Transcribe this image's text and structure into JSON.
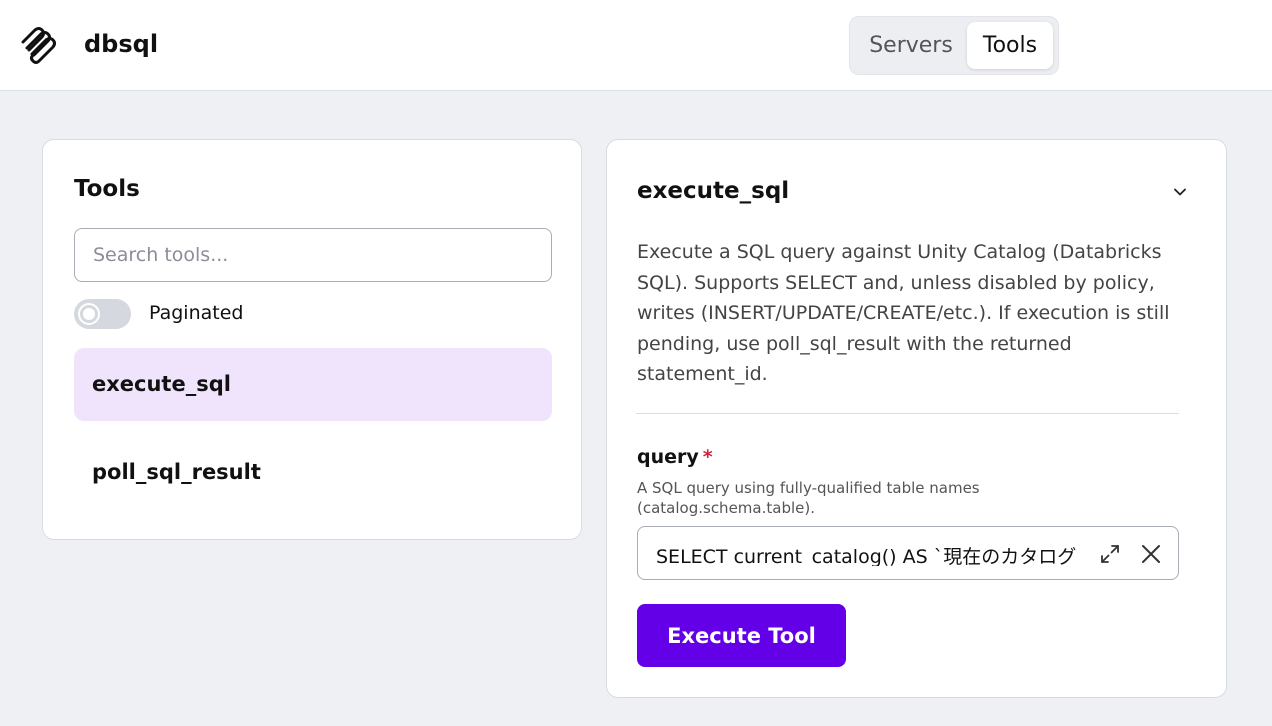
{
  "app": {
    "title": "dbsql",
    "logo_icon": "paperclip-stack-icon"
  },
  "nav": {
    "segments": [
      {
        "label": "Servers",
        "selected": false
      },
      {
        "label": "Tools",
        "selected": true
      }
    ]
  },
  "tools_panel": {
    "heading": "Tools",
    "search_placeholder": "Search tools...",
    "search_value": "",
    "paginated_label": "Paginated",
    "paginated_enabled": false,
    "items": [
      {
        "label": "execute_sql",
        "selected": true
      },
      {
        "label": "poll_sql_result",
        "selected": false
      }
    ]
  },
  "detail": {
    "title": "execute_sql",
    "collapse_icon": "chevron-down-icon",
    "description": "Execute a SQL query against Unity Catalog (Databricks SQL). Supports SELECT and, unless disabled by policy, writes (INSERT/UPDATE/CREATE/etc.). If execution is still pending, use poll_sql_result with the returned statement_id.",
    "param": {
      "name": "query",
      "required_marker": "*",
      "description": "A SQL query using fully-qualified table names (catalog.schema.table).",
      "value": "SELECT current_catalog() AS `現在のカタログ"
    },
    "execute_label": "Execute Tool"
  },
  "colors": {
    "accent": "#6300e8",
    "selected_item_bg": "#efe4fc",
    "required": "#d0243a",
    "page_bg": "#eef0f4"
  }
}
